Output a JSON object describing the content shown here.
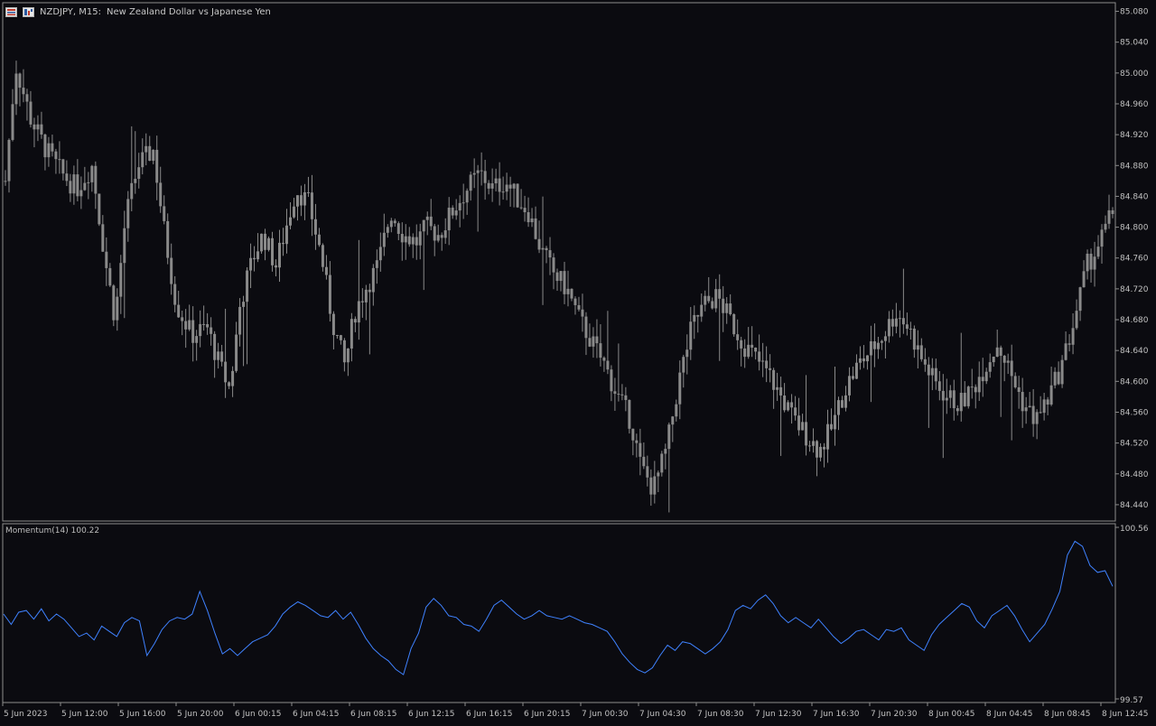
{
  "window": {
    "symbol": "NZDJPY, M15:",
    "description": "New Zealand Dollar vs Japanese Yen",
    "icons": [
      "grid-icon",
      "trade-icon"
    ]
  },
  "indicator": {
    "label": "Momentum(14) 100.22",
    "scale_high": "100.56",
    "scale_low": "99.57"
  },
  "colors": {
    "background": "#0b0b10",
    "candle": "#8a8a8a",
    "momentum": "#3f82ff",
    "axis_text": "#c0c0c0",
    "border": "#8c8c8c"
  },
  "chart_data": [
    {
      "type": "candlestick",
      "title": "NZDJPY, M15",
      "ylim": [
        84.42,
        85.09
      ],
      "y_ticks": [
        "85.080",
        "85.040",
        "85.000",
        "84.960",
        "84.920",
        "84.880",
        "84.840",
        "84.800",
        "84.760",
        "84.720",
        "84.680",
        "84.640",
        "84.600",
        "84.560",
        "84.520",
        "84.480",
        "84.440"
      ],
      "x_ticks": [
        "5 Jun 2023",
        "5 Jun 12:00",
        "5 Jun 16:00",
        "5 Jun 20:00",
        "6 Jun 00:15",
        "6 Jun 04:15",
        "6 Jun 08:15",
        "6 Jun 12:15",
        "6 Jun 16:15",
        "6 Jun 20:15",
        "7 Jun 00:30",
        "7 Jun 04:30",
        "7 Jun 08:30",
        "7 Jun 12:30",
        "7 Jun 16:30",
        "7 Jun 20:30",
        "8 Jun 00:45",
        "8 Jun 04:45",
        "8 Jun 08:45",
        "8 Jun 12:45"
      ],
      "price_path": [
        [
          0,
          84.86
        ],
        [
          4,
          85.01
        ],
        [
          10,
          84.94
        ],
        [
          16,
          84.9
        ],
        [
          22,
          84.87
        ],
        [
          28,
          84.85
        ],
        [
          34,
          84.88
        ],
        [
          39,
          84.76
        ],
        [
          43,
          84.68
        ],
        [
          47,
          84.81
        ],
        [
          52,
          84.88
        ],
        [
          58,
          84.9
        ],
        [
          62,
          84.8
        ],
        [
          67,
          84.7
        ],
        [
          73,
          84.66
        ],
        [
          79,
          84.67
        ],
        [
          84,
          84.62
        ],
        [
          88,
          84.59
        ],
        [
          92,
          84.7
        ],
        [
          97,
          84.76
        ],
        [
          101,
          84.79
        ],
        [
          106,
          84.75
        ],
        [
          110,
          84.8
        ],
        [
          114,
          84.85
        ],
        [
          119,
          84.83
        ],
        [
          124,
          84.76
        ],
        [
          128,
          84.68
        ],
        [
          133,
          84.62
        ],
        [
          137,
          84.69
        ],
        [
          141,
          84.72
        ],
        [
          146,
          84.75
        ],
        [
          151,
          84.82
        ],
        [
          156,
          84.79
        ],
        [
          161,
          84.78
        ],
        [
          165,
          84.8
        ],
        [
          170,
          84.79
        ],
        [
          175,
          84.82
        ],
        [
          181,
          84.85
        ],
        [
          186,
          84.87
        ],
        [
          191,
          84.85
        ],
        [
          196,
          84.86
        ],
        [
          200,
          84.84
        ],
        [
          205,
          84.82
        ],
        [
          210,
          84.77
        ],
        [
          215,
          84.74
        ],
        [
          220,
          84.72
        ],
        [
          225,
          84.68
        ],
        [
          230,
          84.65
        ],
        [
          235,
          84.62
        ],
        [
          240,
          84.58
        ],
        [
          245,
          84.55
        ],
        [
          249,
          84.49
        ],
        [
          254,
          84.46
        ],
        [
          259,
          84.51
        ],
        [
          264,
          84.6
        ],
        [
          269,
          84.67
        ],
        [
          274,
          84.7
        ],
        [
          279,
          84.71
        ],
        [
          284,
          84.68
        ],
        [
          289,
          84.65
        ],
        [
          294,
          84.63
        ],
        [
          299,
          84.61
        ],
        [
          304,
          84.58
        ],
        [
          309,
          84.55
        ],
        [
          314,
          84.53
        ],
        [
          319,
          84.51
        ],
        [
          324,
          84.54
        ],
        [
          329,
          84.59
        ],
        [
          334,
          84.62
        ],
        [
          339,
          84.64
        ],
        [
          344,
          84.66
        ],
        [
          349,
          84.69
        ],
        [
          354,
          84.67
        ],
        [
          359,
          84.63
        ],
        [
          364,
          84.6
        ],
        [
          369,
          84.58
        ],
        [
          374,
          84.57
        ],
        [
          379,
          84.59
        ],
        [
          384,
          84.62
        ],
        [
          389,
          84.65
        ],
        [
          394,
          84.61
        ],
        [
          399,
          84.57
        ],
        [
          404,
          84.55
        ],
        [
          409,
          84.58
        ],
        [
          414,
          84.62
        ],
        [
          419,
          84.68
        ],
        [
          424,
          84.75
        ],
        [
          429,
          84.78
        ],
        [
          434,
          84.82
        ]
      ],
      "price_path_x_note": "",
      "visible_last_close": 84.81
    },
    {
      "type": "line",
      "title": "Momentum(14) 100.22",
      "ylim": [
        99.57,
        100.56
      ],
      "series": [
        {
          "name": "Momentum(14)",
          "values": [
            100.06,
            100.0,
            100.07,
            100.08,
            100.03,
            100.09,
            100.02,
            100.06,
            100.03,
            99.98,
            99.93,
            99.95,
            99.91,
            99.99,
            99.96,
            99.93,
            100.01,
            100.04,
            100.02,
            99.82,
            99.89,
            99.97,
            100.02,
            100.04,
            100.03,
            100.06,
            100.19,
            100.08,
            99.95,
            99.83,
            99.86,
            99.82,
            99.86,
            99.9,
            99.92,
            99.94,
            99.99,
            100.06,
            100.1,
            100.13,
            100.11,
            100.08,
            100.05,
            100.04,
            100.08,
            100.03,
            100.07,
            100.0,
            99.92,
            99.86,
            99.82,
            99.79,
            99.74,
            99.71,
            99.86,
            99.95,
            100.1,
            100.15,
            100.11,
            100.05,
            100.04,
            100.0,
            99.99,
            99.96,
            100.03,
            100.11,
            100.14,
            100.1,
            100.06,
            100.03,
            100.05,
            100.08,
            100.05,
            100.04,
            100.03,
            100.05,
            100.03,
            100.01,
            100.0,
            99.98,
            99.96,
            99.9,
            99.83,
            99.78,
            99.74,
            99.72,
            99.75,
            99.82,
            99.88,
            99.85,
            99.9,
            99.89,
            99.86,
            99.83,
            99.86,
            99.9,
            99.97,
            100.08,
            100.11,
            100.09,
            100.14,
            100.17,
            100.12,
            100.05,
            100.01,
            100.04,
            100.01,
            99.98,
            100.03,
            99.98,
            99.93,
            99.89,
            99.92,
            99.96,
            99.97,
            99.94,
            99.91,
            99.97,
            99.96,
            99.98,
            99.91,
            99.88,
            99.85,
            99.94,
            100.0,
            100.04,
            100.08,
            100.12,
            100.1,
            100.02,
            99.98,
            100.05,
            100.08,
            100.11,
            100.05,
            99.97,
            99.9,
            99.95,
            100.0,
            100.09,
            100.19,
            100.4,
            100.48,
            100.45,
            100.34,
            100.3,
            100.31,
            100.22
          ]
        }
      ]
    }
  ]
}
